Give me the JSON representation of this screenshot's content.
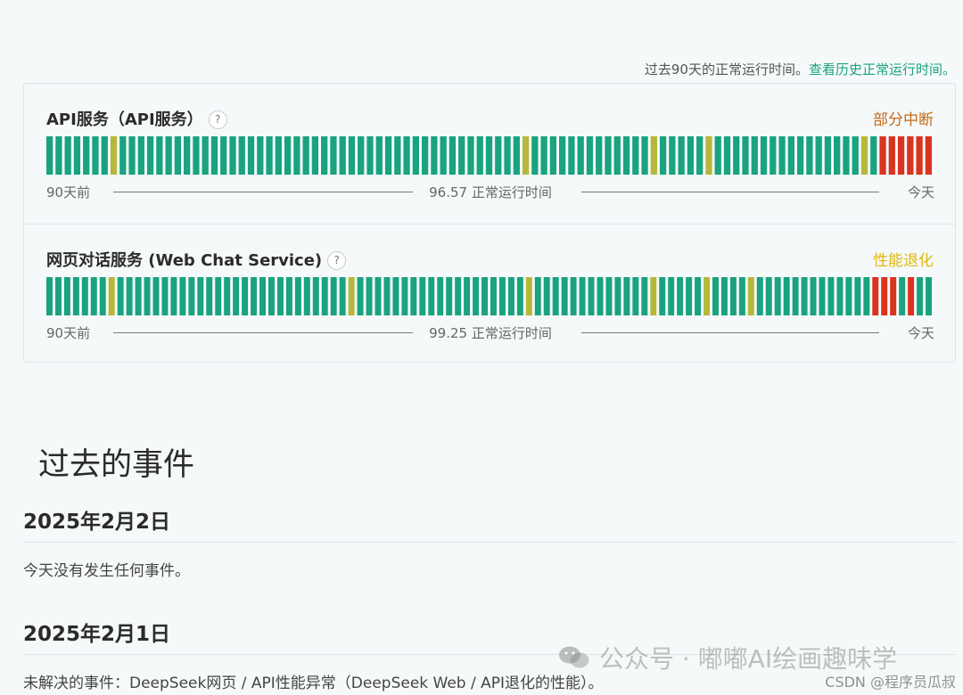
{
  "header": {
    "note": "过去90天的正常运行时间。",
    "link": "查看历史正常运行时间。"
  },
  "colors": {
    "operational": "#19a37e",
    "minor": "#b5b83b",
    "degraded": "#e8c21a",
    "outage": "#d9341f",
    "status_partial": "#c46a16",
    "status_degraded": "#e0b90e"
  },
  "components": [
    {
      "name": "API服务（API服务）",
      "help_icon": "question-mark-icon",
      "status": "部分中断",
      "status_color": "#c46a16",
      "left_label": "90天前",
      "uptime_label": "96.57 正常运行时间",
      "right_label": "今天",
      "days": "gggggggyggggggggggggggggggggggggggggggggggggggggggggygggggggggggggygggggyggggggggggggggggygrrrrrr"
    },
    {
      "name": "网页对话服务 (Web Chat Service)",
      "help_icon": "question-mark-icon",
      "status": "性能退化",
      "status_color": "#e0b90e",
      "left_label": "90天前",
      "uptime_label": "99.25 正常运行时间",
      "right_label": "今天",
      "days": "gggggggyggggggggggggggggggggggggggygggggggggggggggggggygggggggggggggygggggyggggygggggggggggggrrrgrgg"
    }
  ],
  "past_incidents": {
    "title": "过去的事件",
    "days": [
      {
        "date": "2025年2月2日",
        "text": "今天没有发生任何事件。"
      },
      {
        "date": "2025年2月1日",
        "text": "未解决的事件：DeepSeek网页 / API性能异常（DeepSeek Web / API退化的性能）。"
      }
    ]
  },
  "watermark": {
    "text": "公众号 · 嘟嘟AI绘画趣味学",
    "icon": "wechat-icon",
    "csdn": "CSDN @程序员瓜叔"
  }
}
